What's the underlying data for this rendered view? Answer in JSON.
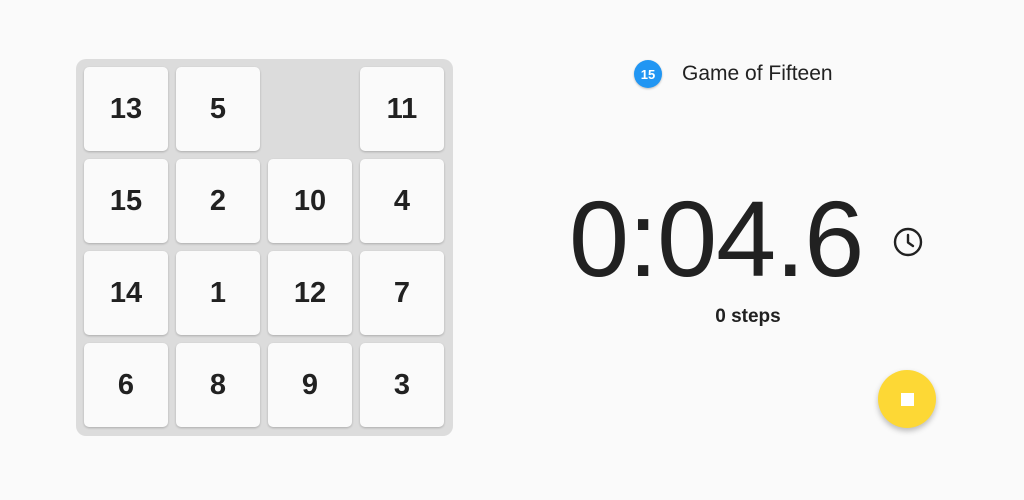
{
  "app": {
    "logo_text": "15",
    "title": "Game of Fifteen",
    "logo_color": "#2196f3"
  },
  "board": {
    "rows": [
      [
        "13",
        "5",
        "",
        "11"
      ],
      [
        "15",
        "2",
        "10",
        "4"
      ],
      [
        "14",
        "1",
        "12",
        "7"
      ],
      [
        "6",
        "8",
        "9",
        "3"
      ]
    ],
    "background_color": "#dcdcdc",
    "tile_color": "#fafafa"
  },
  "timer": {
    "value": "0:04.6",
    "icon": "clock-icon"
  },
  "steps": {
    "label": "0 steps"
  },
  "fab": {
    "icon": "stop-icon",
    "color": "#fdd835"
  }
}
